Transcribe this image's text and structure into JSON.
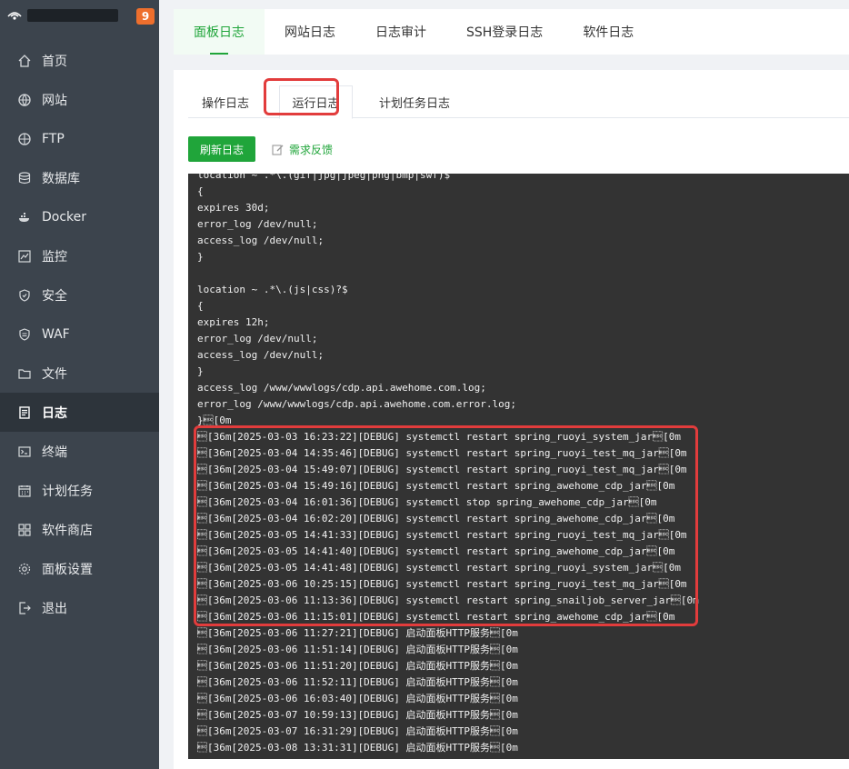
{
  "sidebar": {
    "badge": "9",
    "items": [
      {
        "label": "首页",
        "icon": "home-icon"
      },
      {
        "label": "网站",
        "icon": "globe-icon"
      },
      {
        "label": "FTP",
        "icon": "ftp-icon"
      },
      {
        "label": "数据库",
        "icon": "database-icon"
      },
      {
        "label": "Docker",
        "icon": "docker-icon"
      },
      {
        "label": "监控",
        "icon": "monitor-icon"
      },
      {
        "label": "安全",
        "icon": "shield-icon"
      },
      {
        "label": "WAF",
        "icon": "waf-shield-icon"
      },
      {
        "label": "文件",
        "icon": "folder-icon"
      },
      {
        "label": "日志",
        "icon": "log-icon"
      },
      {
        "label": "终端",
        "icon": "terminal-icon"
      },
      {
        "label": "计划任务",
        "icon": "calendar-icon"
      },
      {
        "label": "软件商店",
        "icon": "grid-icon"
      },
      {
        "label": "面板设置",
        "icon": "gear-icon"
      },
      {
        "label": "退出",
        "icon": "logout-icon"
      }
    ],
    "active_index": 9
  },
  "top_tabs": [
    "面板日志",
    "网站日志",
    "日志审计",
    "SSH登录日志",
    "软件日志"
  ],
  "sub_tabs": [
    "操作日志",
    "运行日志",
    "计划任务日志"
  ],
  "toolbar": {
    "refresh_label": "刷新日志",
    "feedback_label": "需求反馈"
  },
  "colors": {
    "accent": "#20a53a",
    "highlight": "#e23c3c",
    "sidebar_bg": "#3c444d",
    "console_bg": "#333333"
  },
  "log_lines": [
    "location ~ .*\\.(gif|jpg|jpeg|png|bmp|swf)$",
    "{",
    "expires 30d;",
    "error_log /dev/null;",
    "access_log /dev/null;",
    "}",
    "",
    "location ~ .*\\.(js|css)?$",
    "{",
    "expires 12h;",
    "error_log /dev/null;",
    "access_log /dev/null;",
    "}",
    "access_log /www/wwwlogs/cdp.api.awehome.com.log;",
    "error_log /www/wwwlogs/cdp.api.awehome.com.error.log;",
    "}\u001b[0m",
    "\u001b[36m[2025-03-03 16:23:22][DEBUG] systemctl restart spring_ruoyi_system_jar\u001b[0m",
    "\u001b[36m[2025-03-04 14:35:46][DEBUG] systemctl restart spring_ruoyi_test_mq_jar\u001b[0m",
    "\u001b[36m[2025-03-04 15:49:07][DEBUG] systemctl restart spring_ruoyi_test_mq_jar\u001b[0m",
    "\u001b[36m[2025-03-04 15:49:16][DEBUG] systemctl restart spring_awehome_cdp_jar\u001b[0m",
    "\u001b[36m[2025-03-04 16:01:36][DEBUG] systemctl stop spring_awehome_cdp_jar\u001b[0m",
    "\u001b[36m[2025-03-04 16:02:20][DEBUG] systemctl restart spring_awehome_cdp_jar\u001b[0m",
    "\u001b[36m[2025-03-05 14:41:33][DEBUG] systemctl restart spring_ruoyi_test_mq_jar\u001b[0m",
    "\u001b[36m[2025-03-05 14:41:40][DEBUG] systemctl restart spring_awehome_cdp_jar\u001b[0m",
    "\u001b[36m[2025-03-05 14:41:48][DEBUG] systemctl restart spring_ruoyi_system_jar\u001b[0m",
    "\u001b[36m[2025-03-06 10:25:15][DEBUG] systemctl restart spring_ruoyi_test_mq_jar\u001b[0m",
    "\u001b[36m[2025-03-06 11:13:36][DEBUG] systemctl restart spring_snailjob_server_jar\u001b[0m",
    "\u001b[36m[2025-03-06 11:15:01][DEBUG] systemctl restart spring_awehome_cdp_jar\u001b[0m",
    "\u001b[36m[2025-03-06 11:27:21][DEBUG] 启动面板HTTP服务\u001b[0m",
    "\u001b[36m[2025-03-06 11:51:14][DEBUG] 启动面板HTTP服务\u001b[0m",
    "\u001b[36m[2025-03-06 11:51:20][DEBUG] 启动面板HTTP服务\u001b[0m",
    "\u001b[36m[2025-03-06 11:52:11][DEBUG] 启动面板HTTP服务\u001b[0m",
    "\u001b[36m[2025-03-06 16:03:40][DEBUG] 启动面板HTTP服务\u001b[0m",
    "\u001b[36m[2025-03-07 10:59:13][DEBUG] 启动面板HTTP服务\u001b[0m",
    "\u001b[36m[2025-03-07 16:31:29][DEBUG] 启动面板HTTP服务\u001b[0m",
    "\u001b[36m[2025-03-08 13:31:31][DEBUG] 启动面板HTTP服务\u001b[0m"
  ]
}
